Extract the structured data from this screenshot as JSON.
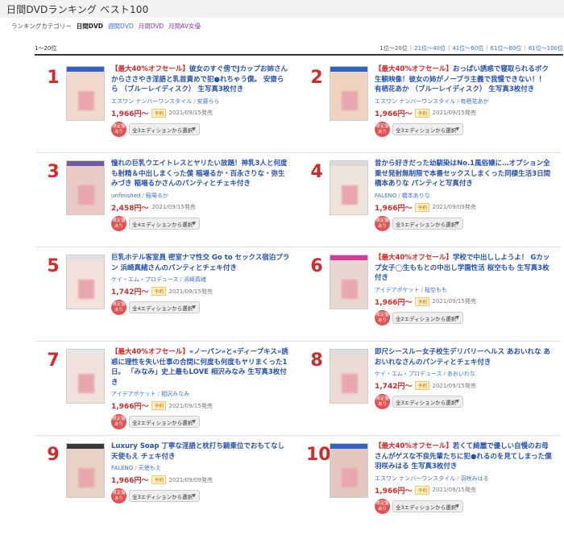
{
  "page": {
    "title": "日間DVDランキング ベスト100"
  },
  "categories": {
    "label": "ランキングカテゴリー",
    "items": [
      {
        "label": "日間DVD",
        "active": true,
        "style": "active"
      },
      {
        "label": "週間DVD",
        "active": false,
        "style": "blue"
      },
      {
        "label": "月間DVD",
        "active": false,
        "style": "purple"
      },
      {
        "label": "月間AV女優",
        "active": false,
        "style": "purple"
      }
    ]
  },
  "range": {
    "current": "1〜20位",
    "pages": [
      "1位〜20位",
      "21位〜40位",
      "41位〜60位",
      "61位〜80位",
      "81位〜100位"
    ]
  },
  "colors": {
    "rank": "#d62a2a",
    "title": "#2450b8",
    "sale": "#e02020",
    "price": "#d62a2a",
    "badge": "#e35151"
  },
  "items": [
    {
      "rank": "1",
      "sale": "【最大40%オフセール】",
      "title": "彼女のすぐ傍でJカップお姉さんからささやき淫語と乳首責めで犯●れちゃう僕。 安齋らら （ブルーレイディスク） 生写真3枚付き",
      "maker": "エスワン ナンバーワンスタイル",
      "actress": "安齋らら",
      "price": "1,966円〜",
      "tag": "予約",
      "date": "2021/09/15発売",
      "badge": "限定盤あり",
      "edition": "全3エディションから選択",
      "band": "#2d63c8",
      "cover": "#f1d9cf"
    },
    {
      "rank": "2",
      "sale": "【最大40%オフセール】",
      "title": "おっぱい誘惑で寝取られるボク生観映像！彼女の姉がノーブラ主義で我慢できない！！ 有栖花あか （ブルーレイディスク） 生写真3枚付き",
      "maker": "エスワン ナンバーワンスタイル",
      "actress": "有栖花あか",
      "price": "1,966円〜",
      "tag": "予約",
      "date": "2021/09/15発売",
      "badge": "限定盤あり",
      "edition": "全3エディションから選択",
      "band": "#2d63c8",
      "cover": "#efd3c1"
    },
    {
      "rank": "3",
      "sale": "",
      "title": "憧れの巨乳ウエイトレスとヤリたい放題！神乳3人と何度も射精＆中出しまくった僕 稲場るか・百永さりな・弥生みづき 稲場るかさんのパンティとチェキ付き",
      "maker": "unfinished",
      "actress": "稲場るか",
      "price": "2,458円〜",
      "tag": "",
      "date": "2021/09/15発売",
      "badge": "限定盤あり",
      "edition": "全4エディションから選択",
      "band": "#6f5ba4",
      "cover": "#e8c9c4"
    },
    {
      "rank": "4",
      "sale": "",
      "title": "昔から好きだった幼馴染はNo.1風俗嬢に…オプション全乗せ発射無制限で本番セックスしまくった同棲生活3日間 橋本ありな パンティと写真付き",
      "maker": "FALENO",
      "actress": "橋本ありな",
      "price": "1,966円〜",
      "tag": "予約",
      "date": "2021/09/09発売",
      "badge": "限定盤あり",
      "edition": "全3エディションから選択",
      "band": "#d9d9d9",
      "cover": "#efe4dc"
    },
    {
      "rank": "5",
      "sale": "",
      "title": "巨乳ホテル客室員 密室ナマ性交 Go to セックス宿泊プラン 浜崎真緒さんのパンティとチェキ付き",
      "maker": "ケイ・エム・プロデュース",
      "actress": "浜崎真緒",
      "price": "1,742円〜",
      "tag": "予約",
      "date": "2021/09/15発売",
      "badge": "限定盤あり",
      "edition": "全4エディションから選択",
      "band": "#e0e0e0",
      "cover": "#f3e1dc"
    },
    {
      "rank": "6",
      "sale": "【最大40%オフセール】",
      "title": "学校で中出ししようよ！ Gカップ女子◯生ももとの中出し学園性活 桜空もも 生写真3枚付き",
      "maker": "アイデアポケット",
      "actress": "桜空もも",
      "price": "1,966円〜",
      "tag": "予約",
      "date": "2021/09/15発売",
      "badge": "限定盤あり",
      "edition": "全2エディションから選択",
      "band": "#d63a9a",
      "cover": "#e9d6d0"
    },
    {
      "rank": "7",
      "sale": "【最大40%オフセール】",
      "title": "«ノーパン»と«ディープキス»誘惑に理性を失い仕事の合間に何度も何度もヤリまくった1日。 「みなみ」史上最もLOVE 相沢みなみ 生写真3枚付き",
      "maker": "アイデアポケット",
      "actress": "相沢みなみ",
      "price": "1,966円〜",
      "tag": "予約",
      "date": "2021/09/15発売",
      "badge": "限定盤あり",
      "edition": "全2エディションから選択",
      "band": "#e6e6e6",
      "cover": "#f1e1dd"
    },
    {
      "rank": "8",
      "sale": "",
      "title": "即尺シースルー女子校生デリバリーヘルス あおいれな あおいれなさんのパンティとチェキ付き",
      "maker": "ケイ・エム・プロデュース",
      "actress": "あおいれな",
      "price": "1,742円〜",
      "tag": "予約",
      "date": "2021/09/15発売",
      "badge": "限定盤あり",
      "edition": "全3エディションから選択",
      "band": "#dcdcdc",
      "cover": "#eadbd4"
    },
    {
      "rank": "9",
      "sale": "",
      "title": "Luxury Soap 丁寧な淫語と枕打ち騎乗位でおもてなし 天使もえ チェキ付き",
      "maker": "FALENO",
      "actress": "天使もえ",
      "price": "1,966円〜",
      "tag": "予約",
      "date": "2021/09/09発売",
      "badge": "限定盤あり",
      "edition": "全3エディションから選択",
      "band": "#3a3a3a",
      "cover": "#e7d2c5"
    },
    {
      "rank": "10",
      "sale": "【最大40%オフセール】",
      "title": "若くて綺麗で優しい自慢のお母さんがゲスな不良先輩たちに犯●れるのを見てしまった僕 羽咲みはる 生写真3枚付き",
      "maker": "エスワン ナンバーワンスタイル",
      "actress": "羽咲みはる",
      "price": "1,966円〜",
      "tag": "予約",
      "date": "2021/09/15発売",
      "badge": "限定盤あり",
      "edition": "全3エディションから選択",
      "band": "#2d63c8",
      "cover": "#e4c8c0"
    }
  ]
}
